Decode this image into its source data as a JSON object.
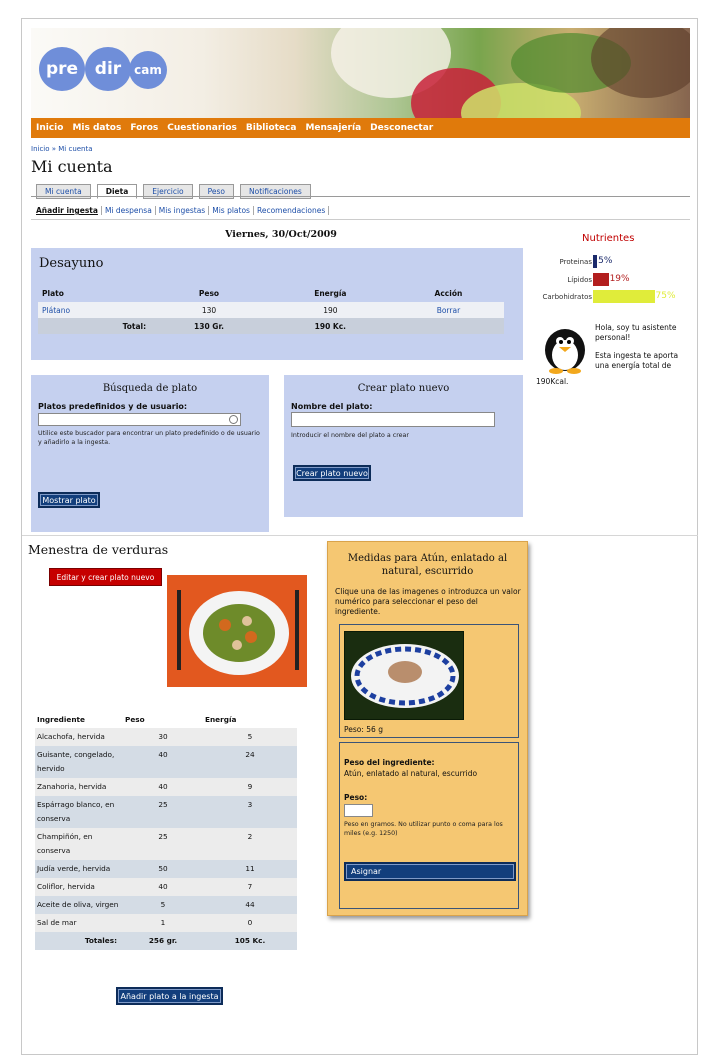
{
  "nav": {
    "logo": [
      "pre",
      "dir",
      "cam"
    ],
    "items": [
      "Inicio",
      "Mis datos",
      "Foros",
      "Cuestionarios",
      "Biblioteca",
      "Mensajería",
      "Desconectar"
    ]
  },
  "breadcrumb": "Inicio » Mi cuenta",
  "page_title": "Mi cuenta",
  "tabs": [
    "Mi cuenta",
    "Dieta",
    "Ejercicio",
    "Peso",
    "Notificaciones"
  ],
  "subtabs": [
    "Añadir ingesta",
    "Mi despensa",
    "Mis ingestas",
    "Mis platos",
    "Recomendaciones"
  ],
  "date": "Viernes, 30/Oct/2009",
  "desayuno": {
    "title": "Desayuno",
    "headers": [
      "Plato",
      "Peso",
      "Energía",
      "Acción"
    ],
    "row": {
      "plato": "Plátano",
      "peso": "130",
      "energia": "190",
      "accion": "Borrar"
    },
    "total": {
      "label": "Total:",
      "peso": "130 Gr.",
      "energia": "190 Kc."
    }
  },
  "busqueda": {
    "title": "Búsqueda de plato",
    "label": "Platos predefinidos y de usuario:",
    "help": "Utilice este buscador para encontrar un plato predefinido o de usuario y añadirlo a la ingesta.",
    "button": "Mostrar plato"
  },
  "crear": {
    "title": "Crear plato nuevo",
    "label": "Nombre del plato:",
    "help": "Introducir el nombre del plato a crear",
    "button": "Crear plato nuevo"
  },
  "nutrientes": {
    "title": "Nutrientes",
    "items": [
      {
        "name": "Proteinas",
        "percent": "5%",
        "value": 5,
        "color": "#1b2a6b"
      },
      {
        "name": "Lípidos",
        "percent": "19%",
        "value": 19,
        "color": "#b21e1e"
      },
      {
        "name": "Carbohidratos",
        "percent": "75%",
        "value": 75,
        "color": "#e0ec3a"
      }
    ]
  },
  "asistente": {
    "line1": "Hola, soy tu asistente personal!",
    "line2": "Esta ingesta te aporta una energía total de",
    "line3": "190Kcal."
  },
  "plato": {
    "name": "Menestra de verduras",
    "edit_button": "Editar y crear plato nuevo",
    "headers": [
      "Ingrediente",
      "Peso",
      "Energía"
    ],
    "rows": [
      [
        "Alcachofa, hervida",
        "30",
        "5"
      ],
      [
        "Guisante, congelado, hervido",
        "40",
        "24"
      ],
      [
        "Zanahoria, hervida",
        "40",
        "9"
      ],
      [
        "Espárrago blanco, en conserva",
        "25",
        "3"
      ],
      [
        "Champiñón, en conserva",
        "25",
        "2"
      ],
      [
        "Judía verde, hervida",
        "50",
        "11"
      ],
      [
        "Coliflor, hervida",
        "40",
        "7"
      ],
      [
        "Aceite de oliva, virgen",
        "5",
        "44"
      ],
      [
        "Sal de mar",
        "1",
        "0"
      ]
    ],
    "totals": {
      "label": "Totales:",
      "peso": "256 gr.",
      "energia": "105 Kc."
    },
    "add_button": "Añadir plato a la ingesta"
  },
  "medidas": {
    "title": "Medidas para Atún, enlatado al natural, escurrido",
    "instructions": "Clique una de las imagenes o introduzca un valor numérico para seleccionar el peso del ingrediente.",
    "photo_caption": "Peso: 56 g",
    "peso_ingrediente_label": "Peso del ingrediente:",
    "ingrediente": "Atún, enlatado al natural, escurrido",
    "peso_label": "Peso:",
    "peso_help": "Peso en gramos. No utilizar punto o coma para los miles (e.g. 1250)",
    "button": "Asignar"
  }
}
